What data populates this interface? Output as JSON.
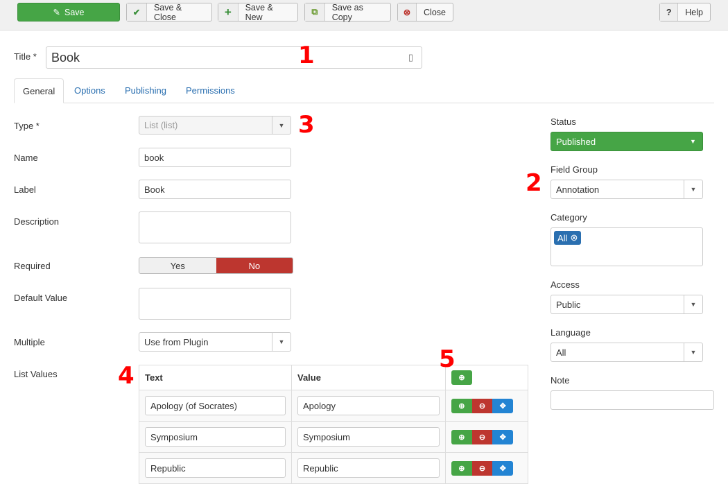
{
  "toolbar": {
    "save": "Save",
    "save_close": "Save & Close",
    "save_new": "Save & New",
    "save_copy": "Save as Copy",
    "close": "Close",
    "help": "Help"
  },
  "title": {
    "label": "Title *",
    "value": "Book"
  },
  "tabs": [
    "General",
    "Options",
    "Publishing",
    "Permissions"
  ],
  "form": {
    "type": {
      "label": "Type *",
      "value": "List (list)"
    },
    "name": {
      "label": "Name",
      "value": "book"
    },
    "label": {
      "label": "Label",
      "value": "Book"
    },
    "description": {
      "label": "Description",
      "value": ""
    },
    "required": {
      "label": "Required",
      "yes": "Yes",
      "no": "No",
      "selected": "No"
    },
    "default_value": {
      "label": "Default Value",
      "value": ""
    },
    "multiple": {
      "label": "Multiple",
      "value": "Use from Plugin"
    },
    "list_values": {
      "label": "List Values",
      "headers": [
        "Text",
        "Value"
      ],
      "rows": [
        {
          "text": "Apology (of Socrates)",
          "value": "Apology"
        },
        {
          "text": "Symposium",
          "value": "Symposium"
        },
        {
          "text": "Republic",
          "value": "Republic"
        }
      ]
    }
  },
  "sidebar": {
    "status": {
      "label": "Status",
      "value": "Published"
    },
    "field_group": {
      "label": "Field Group",
      "value": "Annotation"
    },
    "category": {
      "label": "Category",
      "tag": "All"
    },
    "access": {
      "label": "Access",
      "value": "Public"
    },
    "language": {
      "label": "Language",
      "value": "All"
    },
    "note": {
      "label": "Note",
      "value": ""
    }
  },
  "annotations": [
    "1",
    "2",
    "3",
    "4",
    "5"
  ]
}
